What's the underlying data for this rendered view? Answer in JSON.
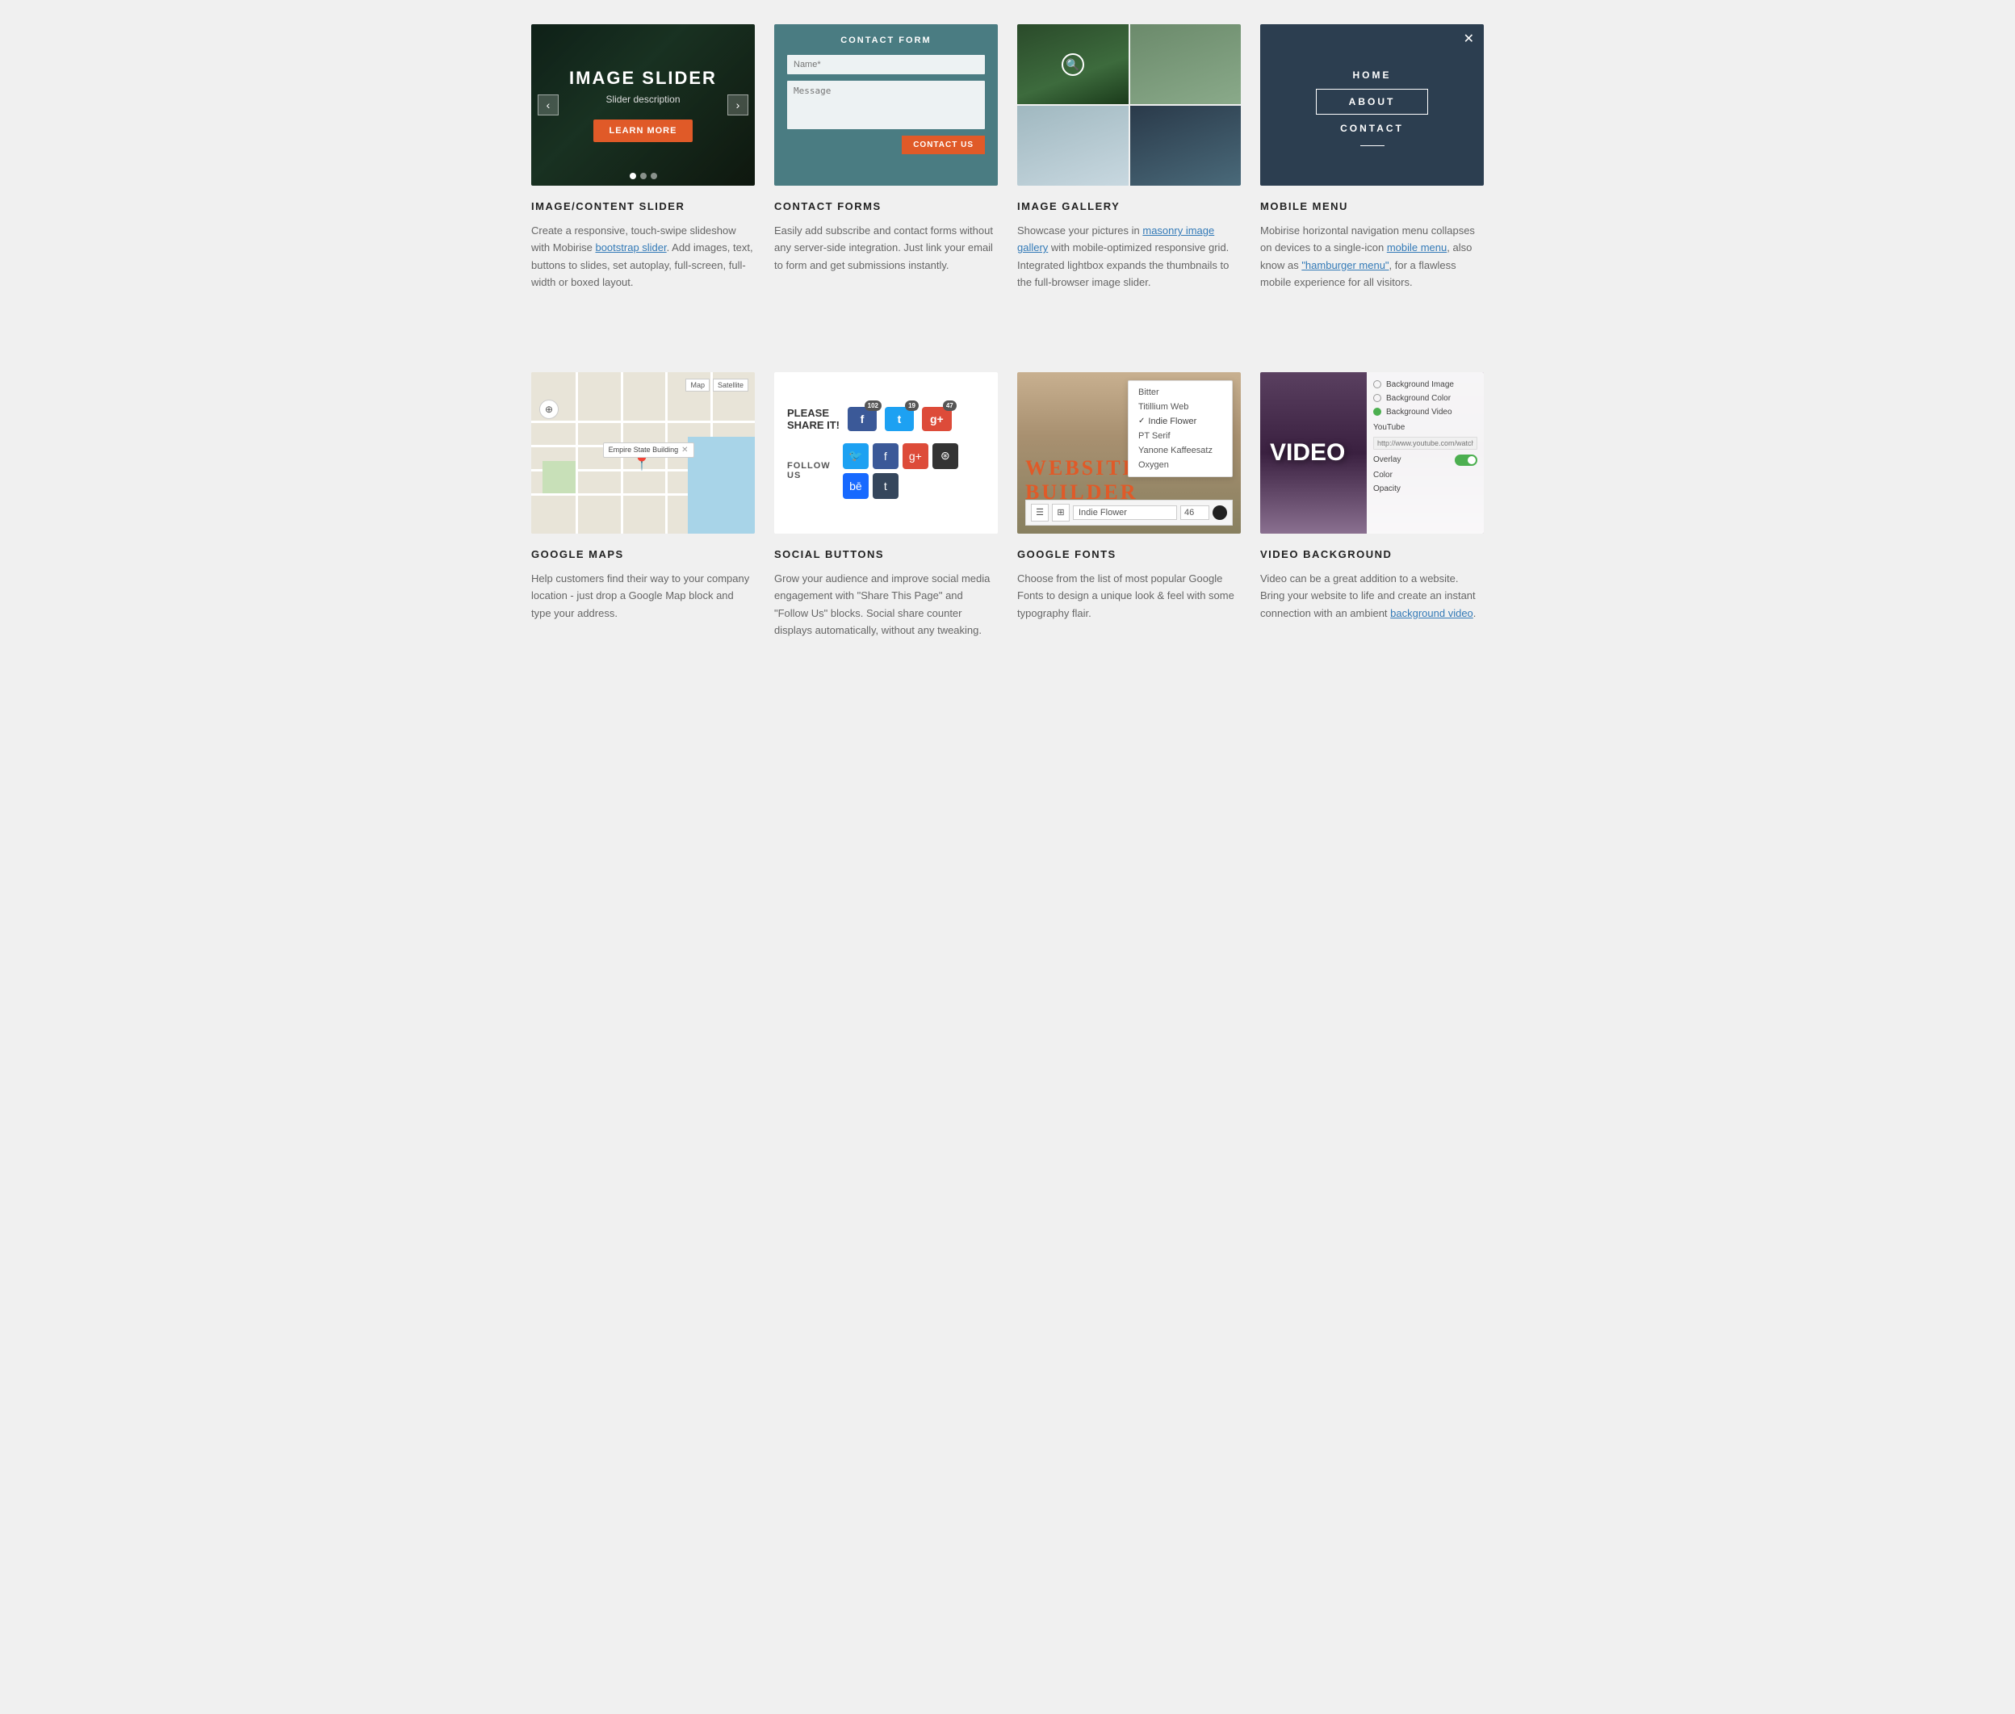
{
  "row1": {
    "cards": [
      {
        "id": "image-slider",
        "title": "IMAGE/CONTENT SLIDER",
        "preview_title": "IMAGE SLIDER",
        "preview_desc": "Slider description",
        "preview_btn": "LEARN MORE",
        "desc": "Create a responsive, touch-swipe slideshow with Mobirise ",
        "link1": "bootstrap slider",
        "desc2": ". Add images, text, buttons to slides, set autoplay, full-screen, full-width or boxed layout.",
        "link1_url": "#",
        "dots": [
          true,
          false,
          false
        ]
      },
      {
        "id": "contact-forms",
        "title": "CONTACT FORMS",
        "header": "CONTACT FORM",
        "name_placeholder": "Name*",
        "message_placeholder": "Message",
        "submit_btn": "CONTACT US",
        "desc": "Easily add subscribe and contact forms without any server-side integration. Just link your email to form and get submissions instantly."
      },
      {
        "id": "image-gallery",
        "title": "IMAGE GALLERY",
        "desc": "Showcase your pictures in ",
        "link1": "masonry image gallery",
        "desc2": " with mobile-optimized responsive grid. Integrated lightbox expands the thumbnails to the full-browser image slider."
      },
      {
        "id": "mobile-menu",
        "title": "MOBILE MENU",
        "menu_items": [
          "HOME",
          "ABOUT",
          "CONTACT"
        ],
        "active_item": "ABOUT",
        "desc": "Mobirise horizontal navigation menu collapses on devices to a single-icon ",
        "link1": "mobile menu",
        "desc2": ", also know as ",
        "link2": "\"hamburger menu\"",
        "desc3": ", for a flawless mobile experience for all visitors."
      }
    ]
  },
  "row2": {
    "cards": [
      {
        "id": "google-maps",
        "title": "GOOGLE MAPS",
        "tooltip_text": "Empire State Building",
        "map_ctrl1": "Map",
        "map_ctrl2": "Satellite",
        "desc": "Help customers find their way to your company location - just drop a Google Map block and type your address."
      },
      {
        "id": "social-buttons",
        "title": "SOCIAL BUTTONS",
        "share_text": "PLEASE\nSHARE IT!",
        "follow_text": "FOLLOW US",
        "share_counts": {
          "fb": "102",
          "tw": "19",
          "gp": "47"
        },
        "desc": "Grow your audience and improve social media engagement with \"Share This Page\" and \"Follow Us\" blocks. Social share counter displays automatically, without any tweaking."
      },
      {
        "id": "google-fonts",
        "title": "GOOGLE FONTS",
        "font_options": [
          "Bitter",
          "Titillium Web",
          "Indie Flower",
          "PT Serif",
          "Yanone Kaffeesatz",
          "Oxygen"
        ],
        "selected_font": "Indie Flower",
        "website_text": "WEBSITE BUILDER",
        "toolbar_icons": [
          "≡",
          "⊞"
        ],
        "font_size": "46",
        "desc": "Choose from the list of most popular Google Fonts to design a unique look & feel with some typography flair."
      },
      {
        "id": "video-background",
        "title": "VIDEO BACKGROUND",
        "video_text": "VIDEO",
        "panel_options": [
          "Background Image",
          "Background Color",
          "Background Video"
        ],
        "active_option": "Background Video",
        "youtube_label": "YouTube",
        "youtube_placeholder": "http://www.youtube.com/watch?",
        "overlay_label": "Overlay",
        "color_label": "Color",
        "opacity_label": "Opacity",
        "desc": "Video can be a great addition to a website. Bring your website to life and create an instant connection with an ambient ",
        "link1": "background video",
        "desc2": "."
      }
    ]
  }
}
